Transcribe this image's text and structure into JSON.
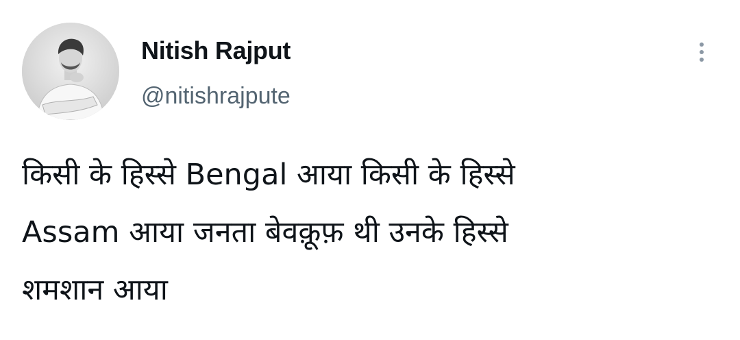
{
  "user": {
    "display_name": "Nitish Rajput",
    "handle": "@nitishrajpute",
    "avatar_icon": "profile-photo"
  },
  "menu": {
    "icon": "more-vertical-icon"
  },
  "tweet": {
    "lines": [
      "किसी के हिस्से Bengal आया किसी के हिस्से",
      "Assam आया जनता बेवक़ूफ़ थी उनके हिस्से",
      "शमशान आया"
    ]
  },
  "colors": {
    "text_primary": "#0f1419",
    "text_secondary": "#536471",
    "menu_dots": "#8b98a5",
    "background": "#ffffff"
  }
}
